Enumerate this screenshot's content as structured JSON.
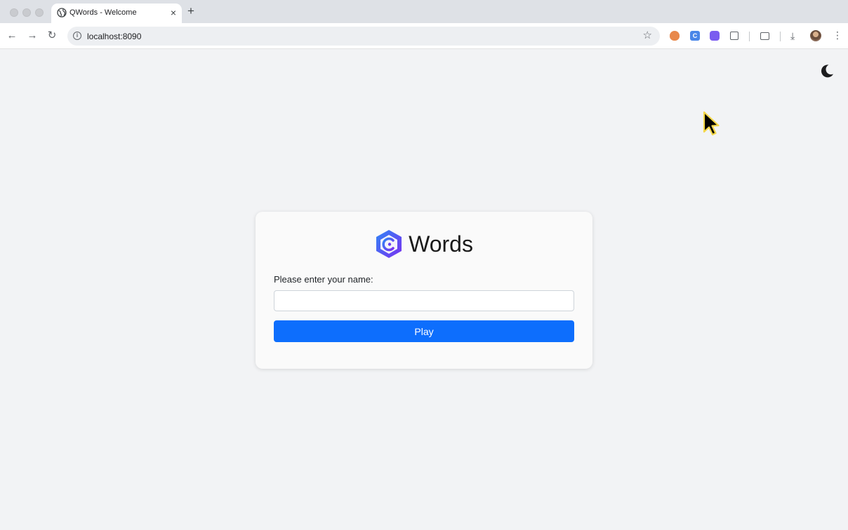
{
  "browser": {
    "tab": {
      "title": "QWords - Welcome",
      "close_label": "×"
    },
    "new_tab_label": "+",
    "address": {
      "url": "localhost:8090"
    },
    "extensions": {
      "second_letter": "C"
    }
  },
  "page": {
    "brand": {
      "name": "Words"
    },
    "form": {
      "label": "Please enter your name:",
      "input_value": "",
      "input_placeholder": "",
      "button_label": "Play"
    }
  },
  "colors": {
    "accent": "#0d6efd",
    "logo_gradient_start": "#3b82f6",
    "logo_gradient_end": "#7c3aed"
  },
  "icons": {
    "back": "arrow-left-icon",
    "forward": "arrow-right-icon",
    "reload": "reload-icon",
    "info": "info-icon",
    "bookmark": "star-icon",
    "theme_toggle": "moon-icon",
    "cursor": "mouse-pointer-icon"
  }
}
